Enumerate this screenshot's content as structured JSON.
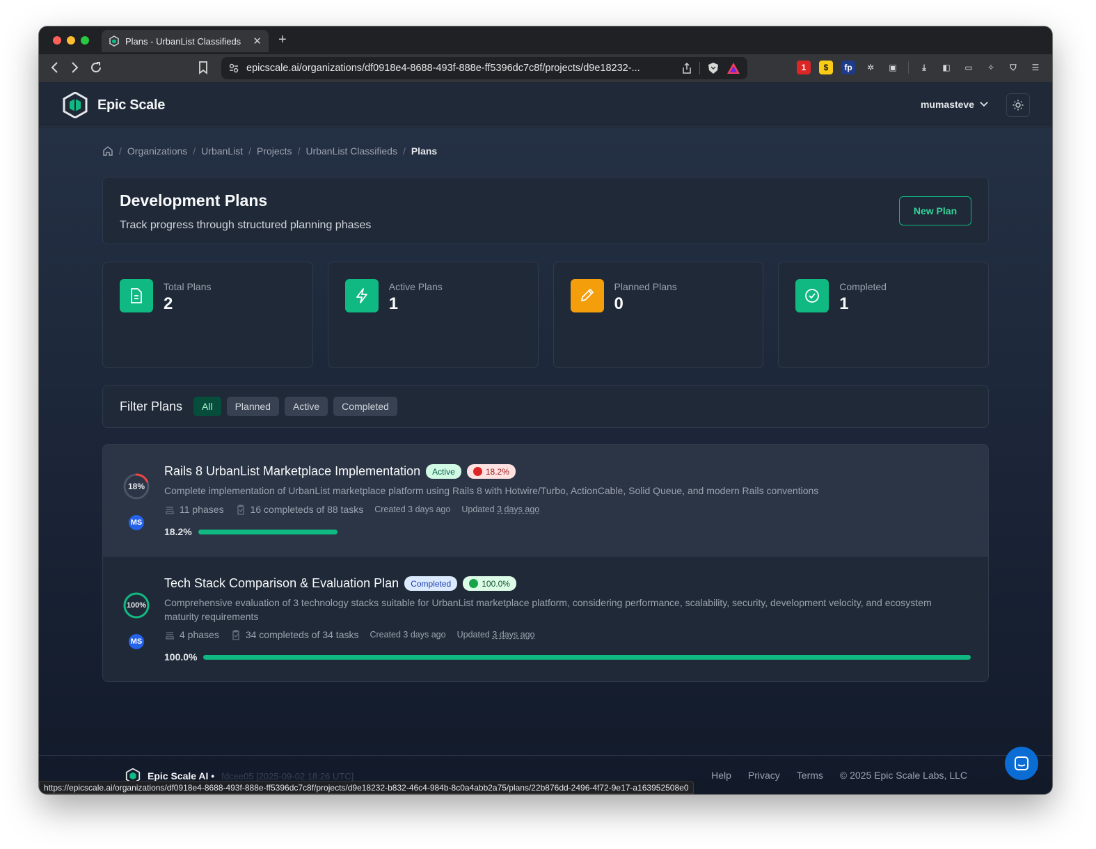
{
  "browser": {
    "tab_title": "Plans - UrbanList Classifieds",
    "url": "epicscale.ai/organizations/df0918e4-8688-493f-888e-ff5396dc7c8f/projects/d9e18232-...",
    "status_url": "https://epicscale.ai/organizations/df0918e4-8688-493f-888e-ff5396dc7c8f/projects/d9e18232-b832-46c4-984b-8c0a4abb2a75/plans/22b876dd-2496-4f72-9e17-a163952508e0"
  },
  "header": {
    "brand": "Epic Scale",
    "username": "mumasteve"
  },
  "breadcrumb": [
    "Organizations",
    "UrbanList",
    "Projects",
    "UrbanList Classifieds",
    "Plans"
  ],
  "page": {
    "title": "Development Plans",
    "subtitle": "Track progress through structured planning phases",
    "new_plan_label": "New Plan"
  },
  "stats": [
    {
      "label": "Total Plans",
      "value": "2",
      "icon": "document-icon",
      "color": "#10b981"
    },
    {
      "label": "Active Plans",
      "value": "1",
      "icon": "bolt-icon",
      "color": "#10b981"
    },
    {
      "label": "Planned Plans",
      "value": "0",
      "icon": "pencil-icon",
      "color": "#f59e0b"
    },
    {
      "label": "Completed",
      "value": "1",
      "icon": "check-circle-icon",
      "color": "#10b981"
    }
  ],
  "filters": {
    "title": "Filter Plans",
    "options": [
      "All",
      "Planned",
      "Active",
      "Completed"
    ],
    "selected": "All"
  },
  "plans": [
    {
      "title": "Rails 8 UrbanList Marketplace Implementation",
      "status": "Active",
      "progress_label": "18.2%",
      "ring_label": "18%",
      "progress": 0.182,
      "avatar": "MS",
      "description": "Complete implementation of UrbanList marketplace platform using Rails 8 with Hotwire/Turbo, ActionCable, Solid Queue, and modern Rails conventions",
      "phases": "11 phases",
      "tasks": "16 completeds of 88 tasks",
      "created": "Created 3 days ago",
      "updated_prefix": "Updated",
      "updated": "3 days ago"
    },
    {
      "title": "Tech Stack Comparison & Evaluation Plan",
      "status": "Completed",
      "progress_label": "100.0%",
      "ring_label": "100%",
      "progress": 1.0,
      "avatar": "MS",
      "description": "Comprehensive evaluation of 3 technology stacks suitable for UrbanList marketplace platform, considering performance, scalability, security, development velocity, and ecosystem maturity requirements",
      "phases": "4 phases",
      "tasks": "34 completeds of 34 tasks",
      "created": "Created 3 days ago",
      "updated_prefix": "Updated",
      "updated": "3 days ago"
    }
  ],
  "footer": {
    "brand": "Epic Scale AI •",
    "version": "fdcee05 [2025-09-02 18:26 UTC]",
    "links": [
      "Help",
      "Privacy",
      "Terms"
    ],
    "copyright": "© 2025 Epic Scale Labs, LLC"
  }
}
